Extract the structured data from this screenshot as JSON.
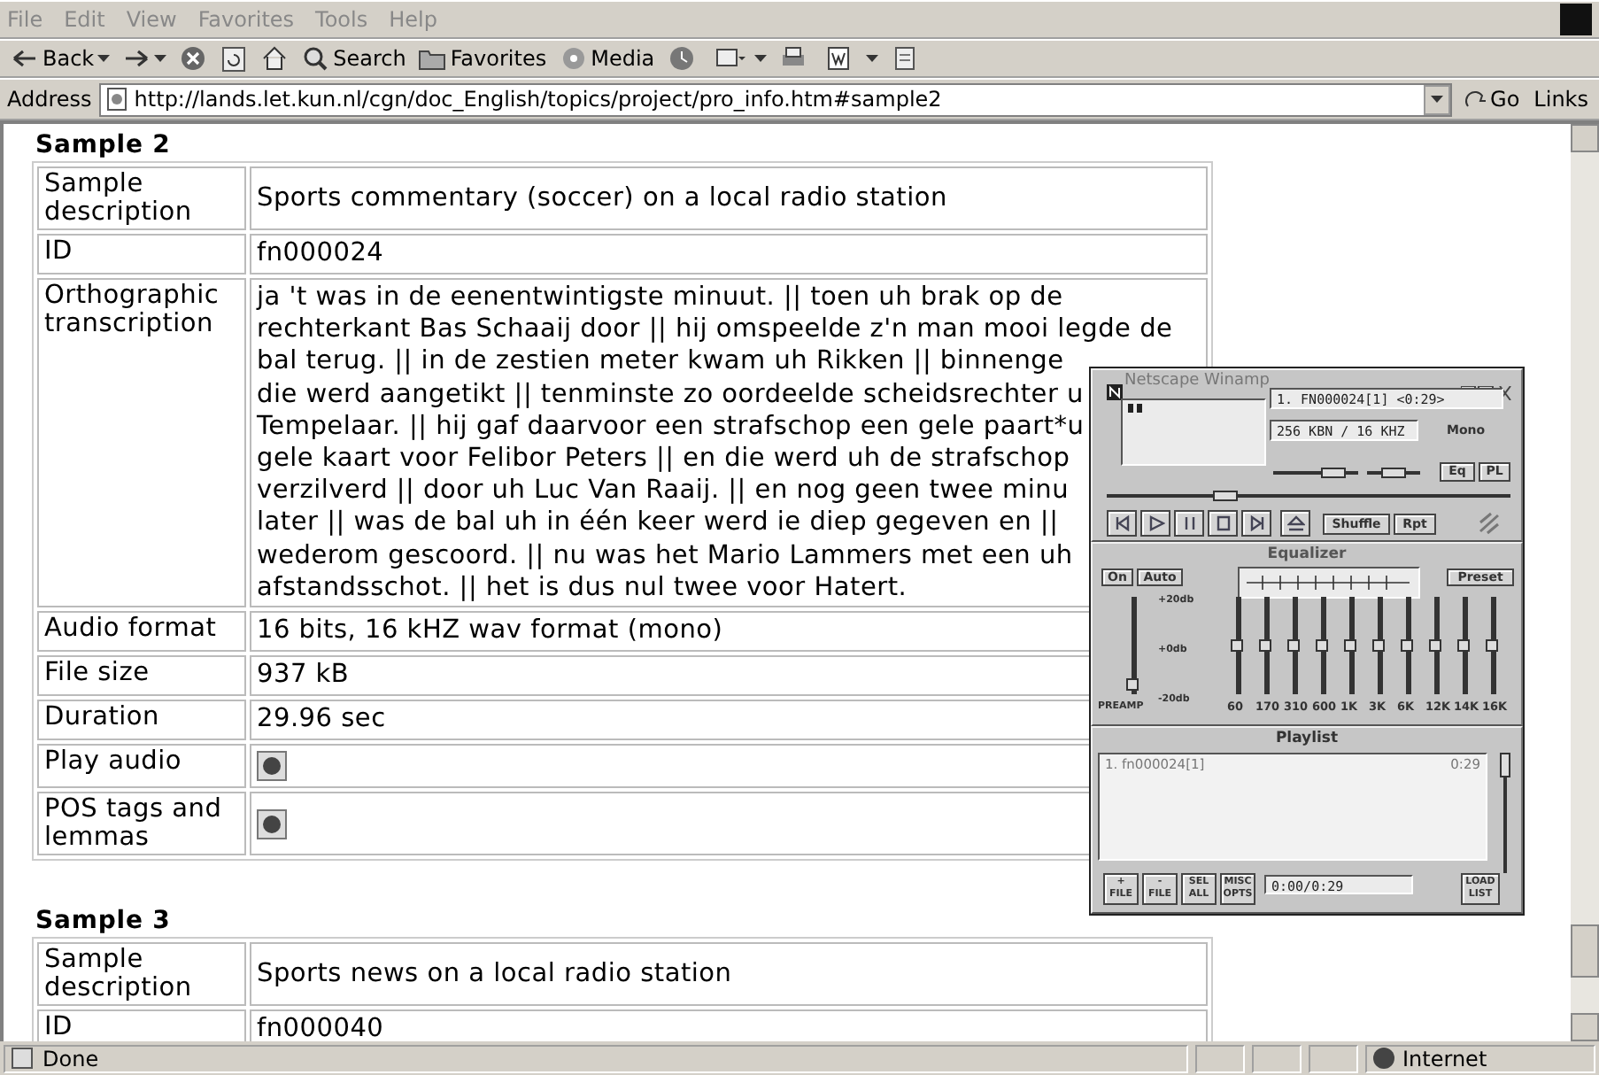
{
  "menu": [
    "File",
    "Edit",
    "View",
    "Favorites",
    "Tools",
    "Help"
  ],
  "toolbar": [
    {
      "kind": "back",
      "label": "Back"
    },
    {
      "kind": "forward"
    },
    {
      "kind": "stop"
    },
    {
      "kind": "refresh"
    },
    {
      "kind": "home"
    },
    {
      "kind": "search",
      "label": "Search"
    },
    {
      "kind": "favorites",
      "label": "Favorites"
    },
    {
      "kind": "media",
      "label": "Media"
    },
    {
      "kind": "history"
    },
    {
      "kind": "mail"
    },
    {
      "kind": "print"
    },
    {
      "kind": "edit"
    },
    {
      "kind": "discuss"
    }
  ],
  "address": {
    "label": "Address",
    "url": "http://lands.let.kun.nl/cgn/doc_English/topics/project/pro_info.htm#sample2",
    "go": "Go",
    "links": "Links"
  },
  "sections": [
    {
      "heading": "Sample 2",
      "rows": [
        {
          "kind": "text",
          "label": "Sample description",
          "value": "Sports commentary (soccer) on a local radio station"
        },
        {
          "kind": "text",
          "label": "ID",
          "value": "fn000024"
        },
        {
          "kind": "lines",
          "label": "Orthographic transcription",
          "lines": [
            "ja 't was in de eenentwintigste minuut. || toen uh brak op de",
            "rechterkant Bas Schaaij door || hij omspeelde z'n man mooi legde de",
            "bal terug. || in de zestien meter kwam uh Rikken || binnenge",
            "die werd aangetikt || tenminste zo oordeelde scheidsrechter u",
            "Tempelaar. || hij gaf daarvoor een strafschop een gele paart*u",
            "gele kaart voor Felibor Peters || en die werd uh de strafschop",
            "verzilverd || door uh Luc Van Raaij. || en nog geen twee minu",
            "later || was de bal uh in één keer werd ie diep gegeven en ||",
            "wederom gescoord. || nu was het Mario Lammers met een uh",
            "afstandsschot. || het is dus nul twee voor Hatert."
          ]
        },
        {
          "kind": "text",
          "label": "Audio format",
          "value": "16 bits, 16 kHZ wav format (mono)"
        },
        {
          "kind": "text",
          "label": "File size",
          "value": "937 kB"
        },
        {
          "kind": "text",
          "label": "Duration",
          "value": "29.96 sec"
        },
        {
          "kind": "audio",
          "label": "Play audio"
        },
        {
          "kind": "audio",
          "label": "POS tags and lemmas"
        }
      ]
    },
    {
      "heading": "Sample 3",
      "rows": [
        {
          "kind": "text",
          "label": "Sample description",
          "value": "Sports news on a local radio station"
        },
        {
          "kind": "text",
          "label": "ID",
          "value": "fn000040"
        }
      ]
    }
  ],
  "winamp": {
    "title": "Netscape Winamp",
    "track": "1. FN000024[1] <0:29>",
    "bitrate": "256 KBN / 16 KHZ",
    "mode": "Mono",
    "volume": {
      "level": 0.8
    },
    "balance": {
      "level": 0.5
    },
    "seek": {
      "level": 0.28
    },
    "eq_button": "Eq",
    "pl_button": "PL",
    "shuffle": "Shuffle",
    "repeat": "Rpt",
    "equalizer": {
      "title": "Equalizer",
      "on": "On",
      "auto": "Auto",
      "preset": "Preset",
      "preamp": {
        "label": "PREAMP",
        "level": 0.05
      },
      "db_labels": [
        "+20db",
        "+0db",
        "-20db"
      ],
      "bands": [
        {
          "label": "60",
          "level": 0.5
        },
        {
          "label": "170",
          "level": 0.5
        },
        {
          "label": "310",
          "level": 0.5
        },
        {
          "label": "600",
          "level": 0.5
        },
        {
          "label": "1K",
          "level": 0.5
        },
        {
          "label": "3K",
          "level": 0.5
        },
        {
          "label": "6K",
          "level": 0.5
        },
        {
          "label": "12K",
          "level": 0.5
        },
        {
          "label": "14K",
          "level": 0.5
        },
        {
          "label": "16K",
          "level": 0.5
        }
      ]
    },
    "playlist": {
      "title": "Playlist",
      "items": [
        {
          "name": "1. fn000024[1]",
          "time": "0:29"
        }
      ],
      "buttons": [
        {
          "top": "+",
          "bottom": "FILE"
        },
        {
          "top": "-",
          "bottom": "FILE"
        },
        {
          "top": "SEL",
          "bottom": "ALL"
        },
        {
          "top": "MISC",
          "bottom": "OPTS"
        }
      ],
      "time": "0:00/0:29",
      "load": {
        "top": "LOAD",
        "bottom": "LIST"
      }
    }
  },
  "status": {
    "text": "Done",
    "zone": "Internet"
  }
}
